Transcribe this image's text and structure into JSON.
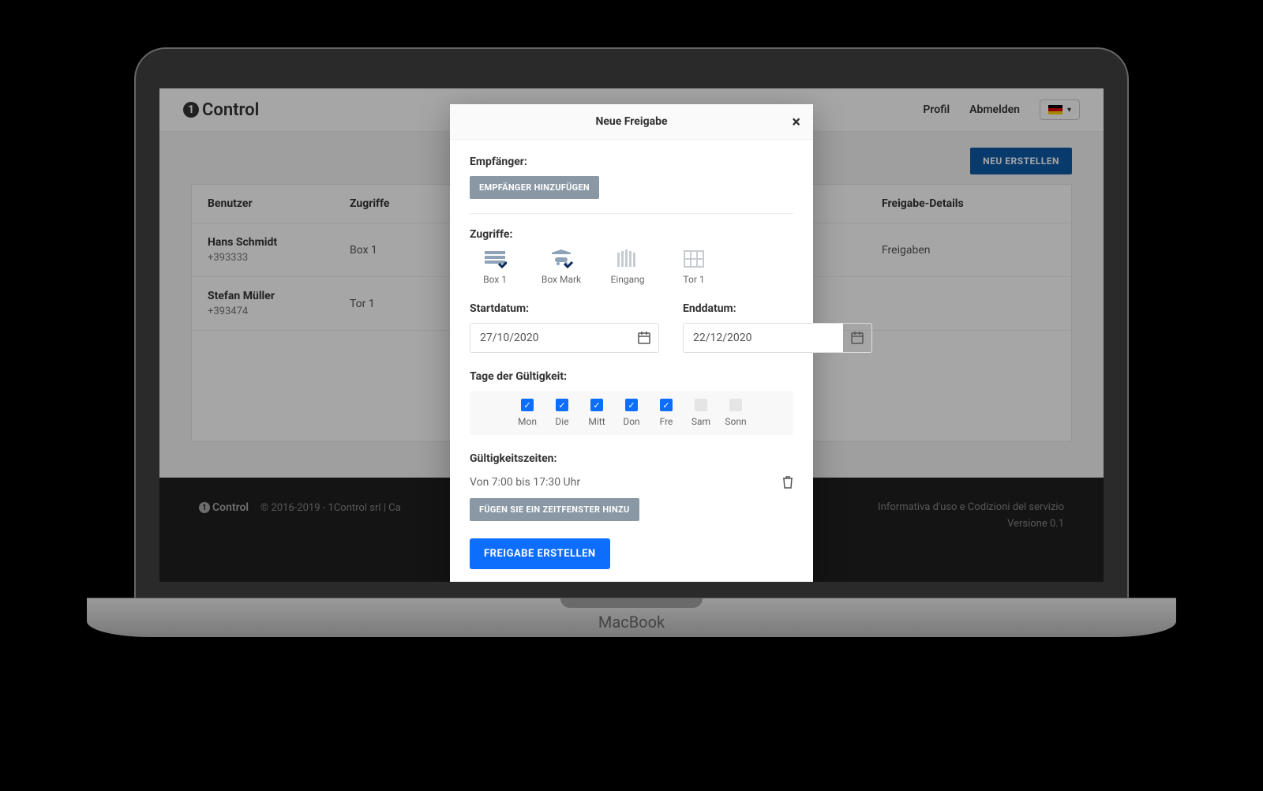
{
  "nav": {
    "brand": "Control",
    "profile": "Profil",
    "logout": "Abmelden"
  },
  "toolbar": {
    "create": "NEU ERSTELLEN"
  },
  "table": {
    "headers": {
      "user": "Benutzer",
      "access": "Zugriffe",
      "details": "Freigabe-Details"
    },
    "rows": [
      {
        "name": "Hans Schmidt",
        "phone": "+393333",
        "access": "Box 1",
        "detail": "Freigaben"
      },
      {
        "name": "Stefan Müller",
        "phone": "+393474",
        "access": "Tor 1",
        "detail": ""
      }
    ]
  },
  "modal": {
    "title": "Neue Freigabe",
    "recipients_label": "Empfänger:",
    "add_recipient": "EMPFÄNGER HINZUFÜGEN",
    "access_label": "Zugriffe:",
    "accesses": [
      {
        "label": "Box 1",
        "selected": true
      },
      {
        "label": "Box Mark",
        "selected": true
      },
      {
        "label": "Eingang",
        "selected": false
      },
      {
        "label": "Tor 1",
        "selected": false
      }
    ],
    "start_label": "Startdatum:",
    "start_value": "27/10/2020",
    "end_label": "Enddatum:",
    "end_value": "22/12/2020",
    "validity_days_label": "Tage der Gültigkeit:",
    "days": [
      {
        "label": "Mon",
        "on": true
      },
      {
        "label": "Die",
        "on": true
      },
      {
        "label": "Mitt",
        "on": true
      },
      {
        "label": "Don",
        "on": true
      },
      {
        "label": "Fre",
        "on": true
      },
      {
        "label": "Sam",
        "on": false
      },
      {
        "label": "Sonn",
        "on": false
      }
    ],
    "times_label": "Gültigkeitszeiten:",
    "time_text": "Von 7:00 bis 17:30 Uhr",
    "add_timeslot": "FÜGEN SIE EIN ZEITFENSTER HINZU",
    "submit": "FREIGABE ERSTELLEN"
  },
  "footer": {
    "copyright": "© 2016-2019 - 1Control srl | Ca",
    "legal": "Informativa d'uso e Codizioni del servizio",
    "version": "Versione 0.1"
  }
}
